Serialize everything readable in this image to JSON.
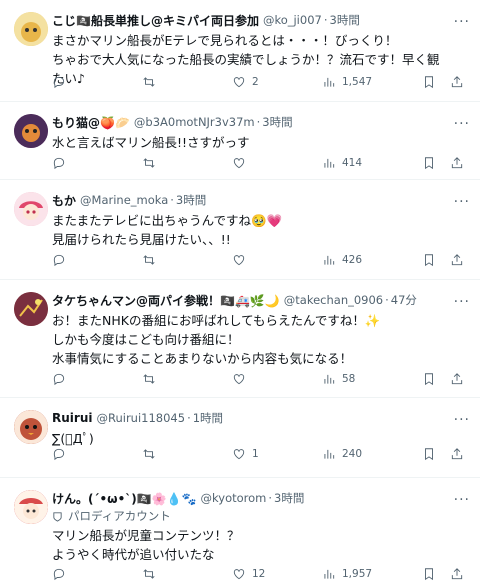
{
  "tweets": [
    {
      "name": "こじ🏴‍☠️船長単推し@キミパイ両日参加",
      "handle": "@ko_ji007",
      "time": "3時間",
      "lines": [
        "まさかマリン船長がEテレで見られるとは・・・！びっくり！",
        "ちゃおで大人気になった船長の実績でしょうか！？流石です！早く観たい♪"
      ],
      "replies": "",
      "retweets": "",
      "likes": "2",
      "views": "1,547",
      "avatar_color": "#e8c76a"
    },
    {
      "name": "もり猫@🍑🥟",
      "handle": "@b3A0motNJr3v37m",
      "time": "3時間",
      "lines": [
        "水と言えばマリン船長!!さすがっす"
      ],
      "replies": "",
      "retweets": "",
      "likes": "",
      "views": "414",
      "avatar_color": "#6b3d6e"
    },
    {
      "name": "もか",
      "handle": "@Marine_moka",
      "time": "3時間",
      "lines": [
        "またまたテレビに出ちゃうんですね🥹💗",
        "見届けられたら見届けたい、、!!"
      ],
      "replies": "",
      "retweets": "",
      "likes": "",
      "views": "426",
      "avatar_color": "#f2b9c8"
    },
    {
      "name": "タケちゃんマン@両パイ参戦！🏴‍☠️🚑🌿🌙",
      "handle": "@takechan_0906",
      "time": "47分",
      "lines": [
        "お！またNHKの番組にお呼ばれしてもらえたんですね！✨",
        "しかも今度はこども向け番組に！",
        "水事情気にすることあまりないから内容も気になる！"
      ],
      "replies": "",
      "retweets": "",
      "likes": "",
      "views": "58",
      "avatar_color": "#8c3a3a"
    },
    {
      "name": "Ruirui",
      "handle": "@Ruirui118045",
      "time": "1時間",
      "lines": [
        "∑(ﾟДﾟ)"
      ],
      "replies": "",
      "retweets": "",
      "likes": "1",
      "views": "240",
      "avatar_color": "#c0533a"
    },
    {
      "name": "けん。(´•ω•`)🏴‍☠️🌸💧🐾",
      "handle": "@kyotorom",
      "time": "3時間",
      "parody": "パロディアカウント",
      "lines": [
        "マリン船長が児童コンテンツ！？",
        "ようやく時代が追い付いたな"
      ],
      "replies": "",
      "retweets": "",
      "likes": "12",
      "views": "1,957",
      "avatar_color": "#d94b4b"
    }
  ],
  "icons": {
    "reply": "reply-icon",
    "retweet": "retweet-icon",
    "like": "heart-icon",
    "views": "views-chart-icon",
    "bookmark": "bookmark-icon",
    "share": "share-icon",
    "more": "more-icon"
  },
  "colors": {
    "text": "#0f1419",
    "muted": "#536471",
    "divider": "#eff3f4"
  }
}
